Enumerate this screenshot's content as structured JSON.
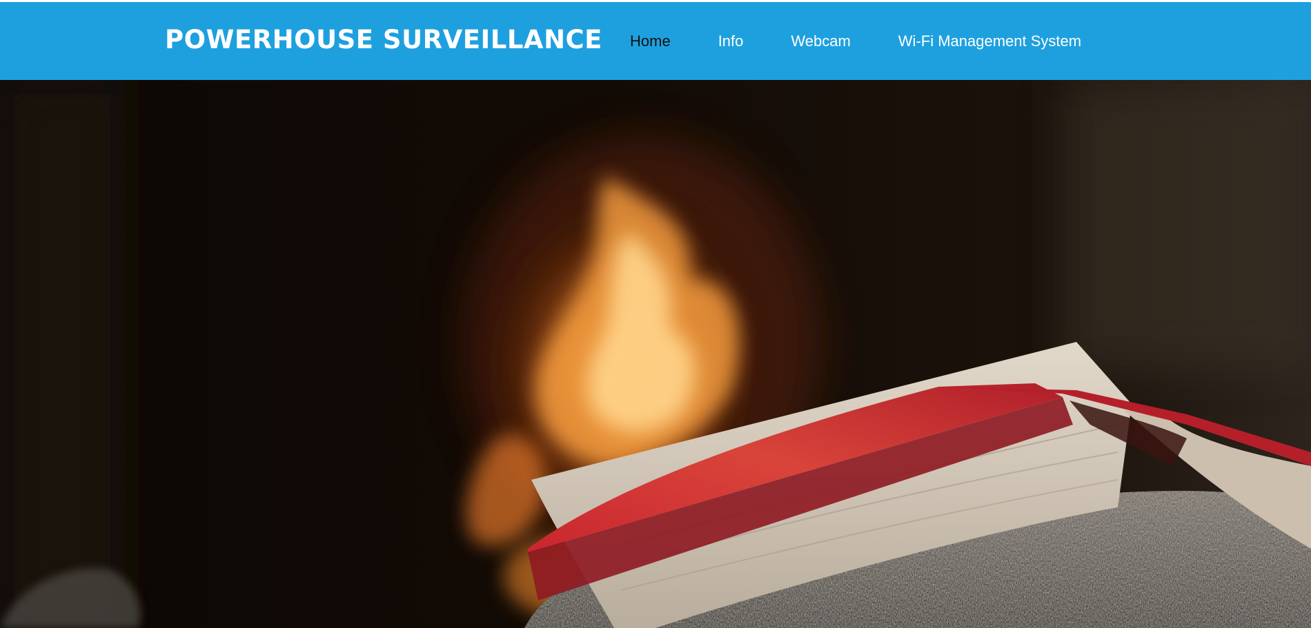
{
  "header": {
    "brand": "POWERHOUSE SURVEILLANCE",
    "nav": [
      {
        "label": "Home",
        "active": true
      },
      {
        "label": "Info",
        "active": false
      },
      {
        "label": "Webcam",
        "active": false
      },
      {
        "label": "Wi-Fi Management System",
        "active": false
      }
    ]
  },
  "colors": {
    "navbar": "#1ea0df",
    "nav_active": "#111111",
    "nav_text": "#ffffff"
  },
  "hero": {
    "image": "fireplace-book-photo"
  }
}
